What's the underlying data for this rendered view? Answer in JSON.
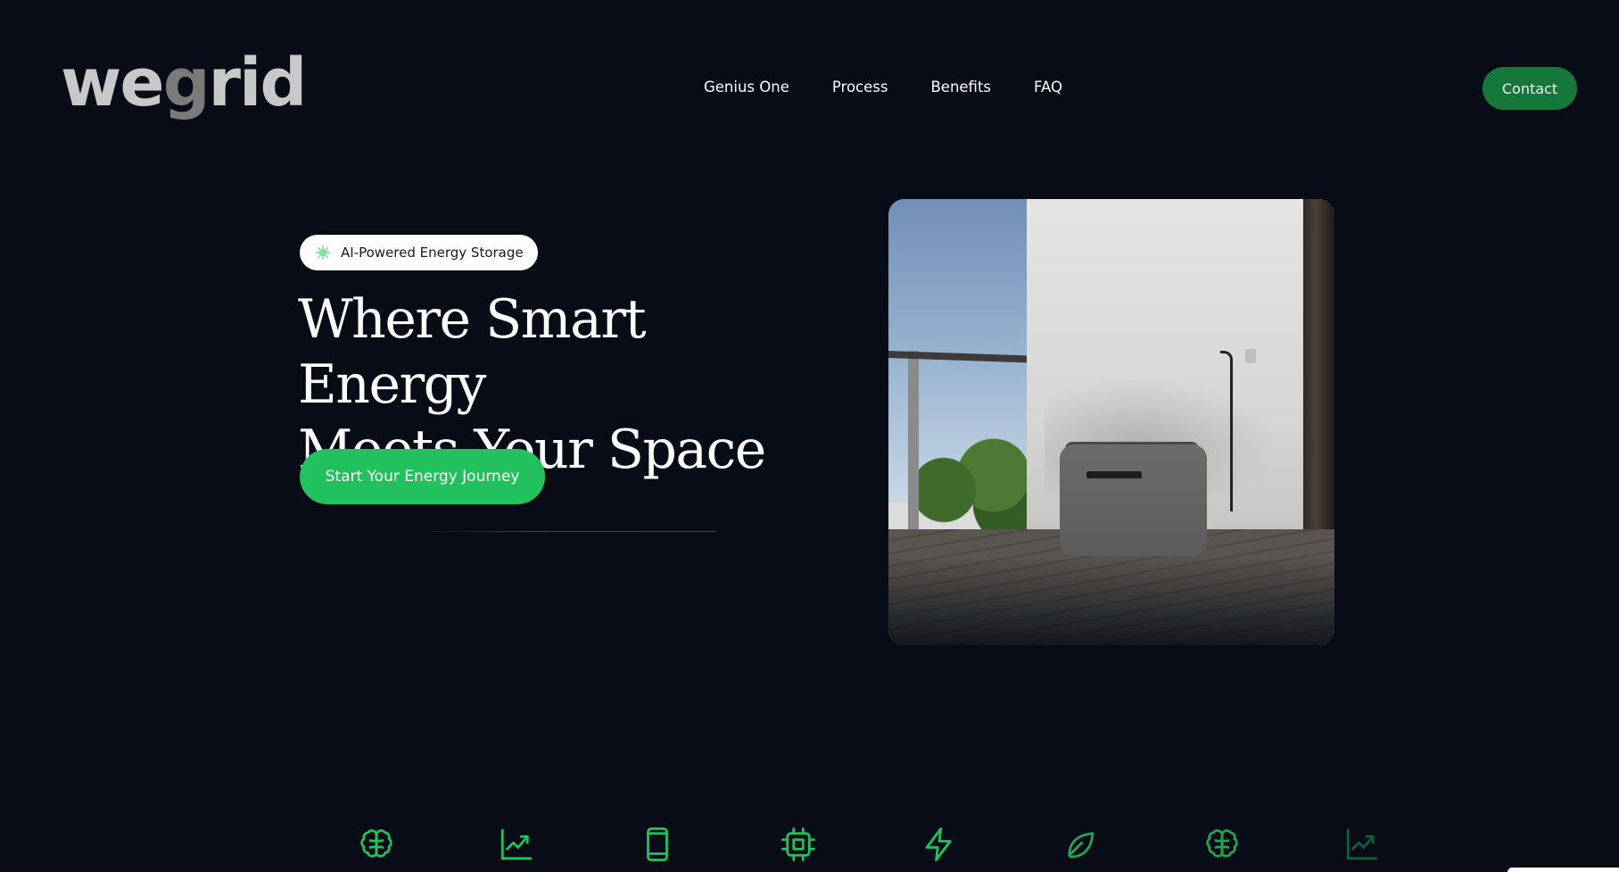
{
  "brand": {
    "logo_text": "wegrid"
  },
  "nav": {
    "items": [
      {
        "label": "Genius One"
      },
      {
        "label": "Process"
      },
      {
        "label": "Benefits"
      },
      {
        "label": "FAQ"
      }
    ],
    "contact_label": "Contact"
  },
  "hero": {
    "badge": "AI-Powered Energy Storage",
    "headline_line1": "Where Smart Energy",
    "headline_line2": "Meets Your Space",
    "cta_label": "Start Your Energy Journey",
    "image_icon": "battery-on-balcony-photo"
  },
  "features": {
    "icons": [
      "brain-icon",
      "trending-up-icon",
      "smartphone-icon",
      "cpu-icon",
      "lightning-icon",
      "leaf-icon",
      "brain-icon",
      "trending-up-icon"
    ]
  },
  "colors": {
    "background": "#070c16",
    "accent": "#22c15e",
    "accent_dark": "#15783a",
    "icon": "#22c15e"
  }
}
